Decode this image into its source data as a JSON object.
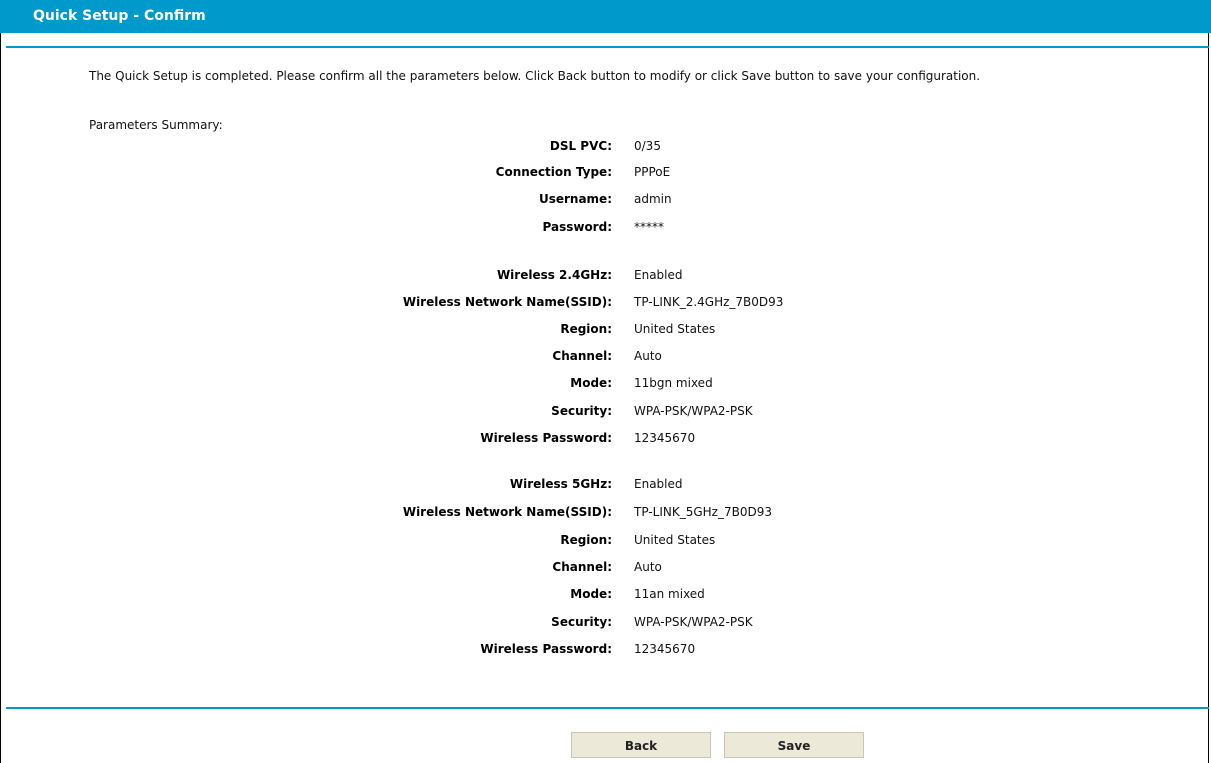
{
  "header": {
    "title": "Quick Setup - Confirm"
  },
  "intro_text": "The Quick Setup is completed. Please confirm all the parameters below. Click Back button to modify or click Save button to save your configuration.",
  "summary_label": "Parameters Summary:",
  "rows": [
    {
      "label": "DSL PVC:",
      "value": "0/35"
    },
    {
      "label": "Connection Type:",
      "value": "PPPoE"
    },
    {
      "label": "Username:",
      "value": "admin"
    },
    {
      "label": "Password:",
      "value": "*****"
    },
    {
      "label": "Wireless 2.4GHz:",
      "value": "Enabled"
    },
    {
      "label": "Wireless Network Name(SSID):",
      "value": "TP-LINK_2.4GHz_7B0D93"
    },
    {
      "label": "Region:",
      "value": "United States"
    },
    {
      "label": "Channel:",
      "value": "Auto"
    },
    {
      "label": "Mode:",
      "value": "11bgn mixed"
    },
    {
      "label": "Security:",
      "value": "WPA-PSK/WPA2-PSK"
    },
    {
      "label": "Wireless Password:",
      "value": "12345670"
    },
    {
      "label": "Wireless 5GHz:",
      "value": "Enabled"
    },
    {
      "label": "Wireless Network Name(SSID):",
      "value": "TP-LINK_5GHz_7B0D93"
    },
    {
      "label": "Region:",
      "value": "United States"
    },
    {
      "label": "Channel:",
      "value": "Auto"
    },
    {
      "label": "Mode:",
      "value": "11an mixed"
    },
    {
      "label": "Security:",
      "value": "WPA-PSK/WPA2-PSK"
    },
    {
      "label": "Wireless Password:",
      "value": "12345670"
    }
  ],
  "buttons": {
    "back": "Back",
    "save": "Save"
  },
  "colors": {
    "accent": "#0099cc",
    "button_bg": "#ece9d8"
  }
}
